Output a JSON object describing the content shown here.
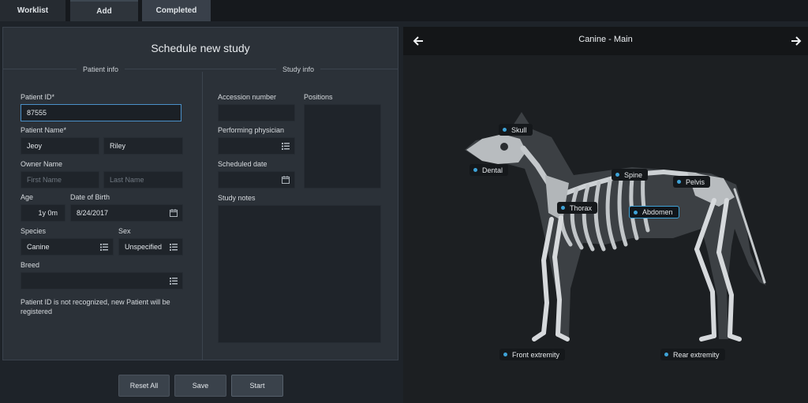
{
  "tabs": [
    {
      "label": "Worklist"
    },
    {
      "label": "Add"
    },
    {
      "label": "Completed"
    }
  ],
  "form": {
    "title": "Schedule new study",
    "patient_section": "Patient info",
    "study_section": "Study info",
    "patient_id": {
      "label": "Patient ID*",
      "value": "87555"
    },
    "patient_name": {
      "label": "Patient Name*",
      "first": "Jeoy",
      "last": "Riley"
    },
    "owner_name": {
      "label": "Owner Name",
      "first_placeholder": "First Name",
      "last_placeholder": "Last Name"
    },
    "age": {
      "label": "Age",
      "value": "1y 0m"
    },
    "dob": {
      "label": "Date of Birth",
      "value": "8/24/2017"
    },
    "species": {
      "label": "Species",
      "value": "Canine"
    },
    "sex": {
      "label": "Sex",
      "value": "Unspecified"
    },
    "breed": {
      "label": "Breed",
      "value": ""
    },
    "notice": "Patient ID is not recognized, new Patient will be registered",
    "accession": {
      "label": "Accession number",
      "value": ""
    },
    "physician": {
      "label": "Performing physician",
      "value": ""
    },
    "scheduled": {
      "label": "Scheduled date",
      "value": ""
    },
    "positions": {
      "label": "Positions"
    },
    "notes": {
      "label": "Study notes"
    }
  },
  "buttons": {
    "reset": "Reset All",
    "save": "Save",
    "start": "Start"
  },
  "viewer": {
    "title": "Canine - Main",
    "selected_region": "Abdomen",
    "regions": [
      {
        "label": "Skull"
      },
      {
        "label": "Dental"
      },
      {
        "label": "Spine"
      },
      {
        "label": "Pelvis"
      },
      {
        "label": "Thorax"
      },
      {
        "label": "Abdomen"
      },
      {
        "label": "Front extremity"
      },
      {
        "label": "Rear extremity"
      }
    ]
  },
  "colors": {
    "accent": "#3ea3d8",
    "panel": "#2b3138",
    "viewer_bg": "#1c1f22"
  }
}
